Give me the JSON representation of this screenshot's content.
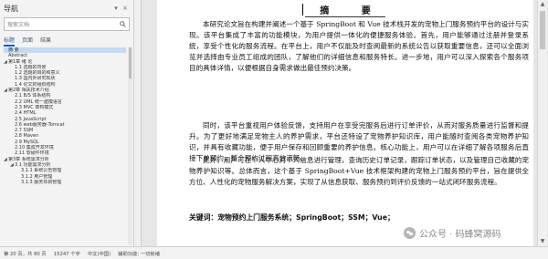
{
  "nav": {
    "title": "导航",
    "close_glyph": "×",
    "search_placeholder": "搜索文档",
    "tabs": [
      "标题",
      "页面",
      "结果"
    ],
    "items": [
      {
        "text": "摘  要",
        "level": 0,
        "selected": true,
        "toggle": ""
      },
      {
        "text": "Abstract",
        "level": 0,
        "toggle": ""
      },
      {
        "text": "第1章 绪 论",
        "level": 0,
        "toggle": "◢"
      },
      {
        "text": "1.1 选题的背景",
        "level": 1,
        "toggle": ""
      },
      {
        "text": "1.2 选题的目的和意义",
        "level": 1,
        "toggle": ""
      },
      {
        "text": "1.3 国内外研究现状",
        "level": 1,
        "toggle": ""
      },
      {
        "text": "1.4 论文的组织结构",
        "level": 1,
        "toggle": ""
      },
      {
        "text": "第2章 相关技术介绍",
        "level": 0,
        "toggle": "◢"
      },
      {
        "text": "2.1 B/S 体系结构",
        "level": 1,
        "toggle": ""
      },
      {
        "text": "2.2 UML 统一建模语言",
        "level": 1,
        "toggle": ""
      },
      {
        "text": "2.3 MVC 架构模式",
        "level": 1,
        "toggle": ""
      },
      {
        "text": "2.4 HTML",
        "level": 1,
        "toggle": ""
      },
      {
        "text": "2.5 JavaScript",
        "level": 1,
        "toggle": ""
      },
      {
        "text": "2.6 web服务器-Tomcat",
        "level": 1,
        "toggle": ""
      },
      {
        "text": "2.7 SSM",
        "level": 1,
        "toggle": ""
      },
      {
        "text": "2.8 Maven",
        "level": 1,
        "toggle": ""
      },
      {
        "text": "2.9 MySQL",
        "level": 1,
        "toggle": ""
      },
      {
        "text": "2.10 集成开发环境",
        "level": 1,
        "toggle": ""
      },
      {
        "text": "2.11 软硬件环境",
        "level": 1,
        "toggle": ""
      },
      {
        "text": "第3章 系统需求分析",
        "level": 0,
        "toggle": "◢"
      },
      {
        "text": "3.1 功能需求分析",
        "level": 1,
        "toggle": "◢"
      },
      {
        "text": "3.1.1 系统公告管理",
        "level": 2,
        "toggle": ""
      },
      {
        "text": "3.1.2 用户管理",
        "level": 2,
        "toggle": ""
      },
      {
        "text": "3.1.3 服务项目管理",
        "level": 2,
        "toggle": ""
      }
    ]
  },
  "document": {
    "title": "摘  要",
    "paragraphs": [
      "本研究论文旨在构建并阐述一个基于 SpringBoot 和 Vue 技术栈开发的宠物上门服务预约平台的设计与实现。该平台集成了丰富的功能模块，为用户提供一体化的便捷服务体验。首先，用户能够通过注册并登录系统，享受个性化的服务流程。在平台上，用户不仅能及时查阅最新的系统公告以获取重要信息，还可以全面浏览并选择由专业员工组成的团队，了解他们的详细信息和服务特长。进一步地，用户可以深入探索各个服务项目的具体详情，以便根据自身需求做出最佳预约决策。",
      "同时，该平台重视用户体验反馈，支持用户在享受完服务后进行订单评价，从而对服务质量进行监督和提升。为了更好地满足宠物主人的养护需求，平台还特设了宠物养护知识库，用户能随时查阅各类宠物养护知识，并具有收藏功能，便于用户保存和回顾重要的养护信息。核心功能上，用户可以在详细了解各项服务后直接下单预约，整个预约过程高效流畅。",
      "此外，用户可在个人中心对个人信息进行管理，查询历史订单记录，跟踪订单状态，以及管理自己收藏的宠物养护知识等。总体而言，这个基于 SpringBoot+Vue 技术框架构建的宠物上门服务预约平台，旨在提供全方位、人性化的宠物服务解决方案，实现了从信息获取、服务预约到评价反馈的一站式闭环服务流程。"
    ],
    "keywords_label": "关键词：",
    "keywords": "宠物预约上门服务系统；SpringBoot；SSM；Vue；"
  },
  "status": {
    "page": "第 20 页，共 80 页",
    "words": "15247 个字",
    "lang": "中文(中国)",
    "mode": "辅助功能: 一切就绪"
  },
  "watermark": {
    "text": "公众号 · 码蜂窝源码"
  }
}
